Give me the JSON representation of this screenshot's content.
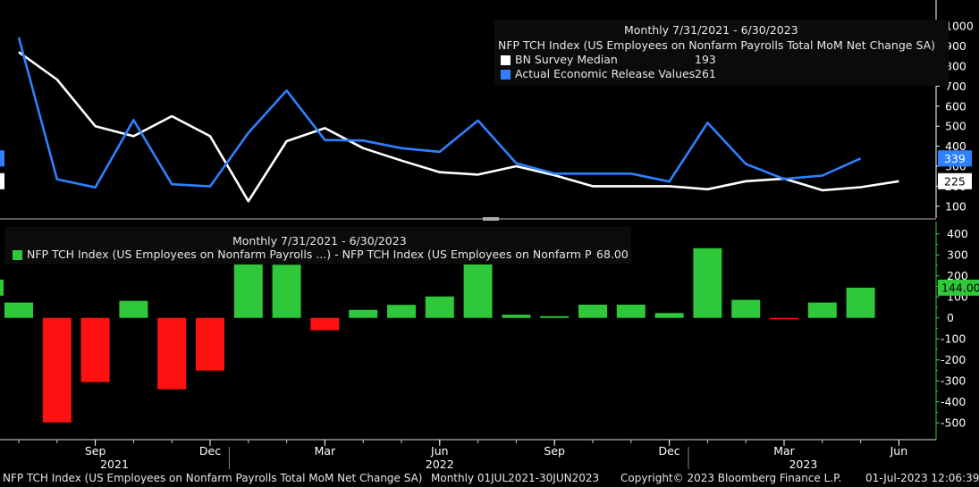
{
  "colors": {
    "background": "#000000",
    "survey": "#ffffff",
    "actual": "#2f80ff",
    "positive": "#2ec83a",
    "negative": "#ff1111",
    "axis_text": "#ffffff",
    "grid": "#3a3a3a"
  },
  "top_legend": {
    "period": "Monthly 7/31/2021 - 6/30/2023",
    "title": "NFP TCH Index (US Employees on Nonfarm Payrolls Total MoM Net Change SA)",
    "series1_label": "BN Survey Median",
    "series1_value": "193",
    "series2_label": "Actual Economic Release Values",
    "series2_value": "261"
  },
  "bottom_legend": {
    "period": "Monthly 7/31/2021 - 6/30/2023",
    "label": "NFP TCH Index (US Employees on Nonfarm Payrolls ...) - NFP TCH Index (US Employees on Nonfarm P",
    "value": "68.00"
  },
  "footer": {
    "series": "NFP TCH Index (US Employees on Nonfarm Payrolls Total MoM Net Change SA)",
    "range": "Monthly 01JUL2021-30JUN2023",
    "copyright": "Copyright© 2023 Bloomberg Finance L.P.",
    "timestamp": "01-Jul-2023 12:06:39"
  },
  "chart_data": [
    {
      "type": "line",
      "x": [
        "2021-07",
        "2021-08",
        "2021-09",
        "2021-10",
        "2021-11",
        "2021-12",
        "2022-01",
        "2022-02",
        "2022-03",
        "2022-04",
        "2022-05",
        "2022-06",
        "2022-07",
        "2022-08",
        "2022-09",
        "2022-10",
        "2022-11",
        "2022-12",
        "2023-01",
        "2023-02",
        "2023-03",
        "2023-04",
        "2023-05",
        "2023-06"
      ],
      "series": [
        {
          "name": "BN Survey Median",
          "values": [
            870,
            733,
            500,
            450,
            550,
            450,
            125,
            425,
            490,
            390,
            328,
            270,
            258,
            300,
            255,
            200,
            200,
            200,
            185,
            225,
            238,
            180,
            195,
            225
          ]
        },
        {
          "name": "Actual Economic Release Values",
          "values": [
            943,
            235,
            194,
            531,
            210,
            199,
            467,
            678,
            431,
            428,
            390,
            372,
            528,
            315,
            263,
            263,
            263,
            223,
            517,
            311,
            236,
            253,
            339,
            null
          ]
        }
      ],
      "ylim": [
        50,
        1050
      ],
      "yticks": [
        100,
        200,
        300,
        400,
        500,
        600,
        700,
        800,
        900,
        1000
      ],
      "last_value_labels": [
        {
          "series": "Actual Economic Release Values",
          "value": 339,
          "text": "339"
        },
        {
          "series": "BN Survey Median",
          "value": 225,
          "text": "225"
        }
      ]
    },
    {
      "type": "bar",
      "x": [
        "2021-07",
        "2021-08",
        "2021-09",
        "2021-10",
        "2021-11",
        "2021-12",
        "2022-01",
        "2022-02",
        "2022-03",
        "2022-04",
        "2022-05",
        "2022-06",
        "2022-07",
        "2022-08",
        "2022-09",
        "2022-10",
        "2022-11",
        "2022-12",
        "2023-01",
        "2023-02",
        "2023-03",
        "2023-04",
        "2023-05",
        "2023-06"
      ],
      "values": [
        73,
        -498,
        -306,
        81,
        -340,
        -251,
        342,
        253,
        -59,
        38,
        62,
        102,
        270,
        15,
        8,
        63,
        63,
        23,
        332,
        86,
        -2,
        73,
        144,
        null
      ],
      "ylim": [
        -580,
        450
      ],
      "yticks": [
        -500,
        -400,
        -300,
        -200,
        -100,
        0,
        100,
        200,
        300,
        400
      ],
      "last_value_labels": [
        {
          "value": 144,
          "text": "144.00"
        }
      ]
    }
  ],
  "x_axis": {
    "month_ticks": [
      {
        "index": 2,
        "label": "Sep"
      },
      {
        "index": 5,
        "label": "Dec"
      },
      {
        "index": 8,
        "label": "Mar"
      },
      {
        "index": 11,
        "label": "Jun"
      },
      {
        "index": 14,
        "label": "Sep"
      },
      {
        "index": 17,
        "label": "Dec"
      },
      {
        "index": 20,
        "label": "Mar"
      },
      {
        "index": 23,
        "label": "Jun"
      }
    ],
    "year_labels": [
      {
        "index": 2.5,
        "label": "2021"
      },
      {
        "index": 11,
        "label": "2022"
      },
      {
        "index": 20.5,
        "label": "2023"
      }
    ]
  }
}
